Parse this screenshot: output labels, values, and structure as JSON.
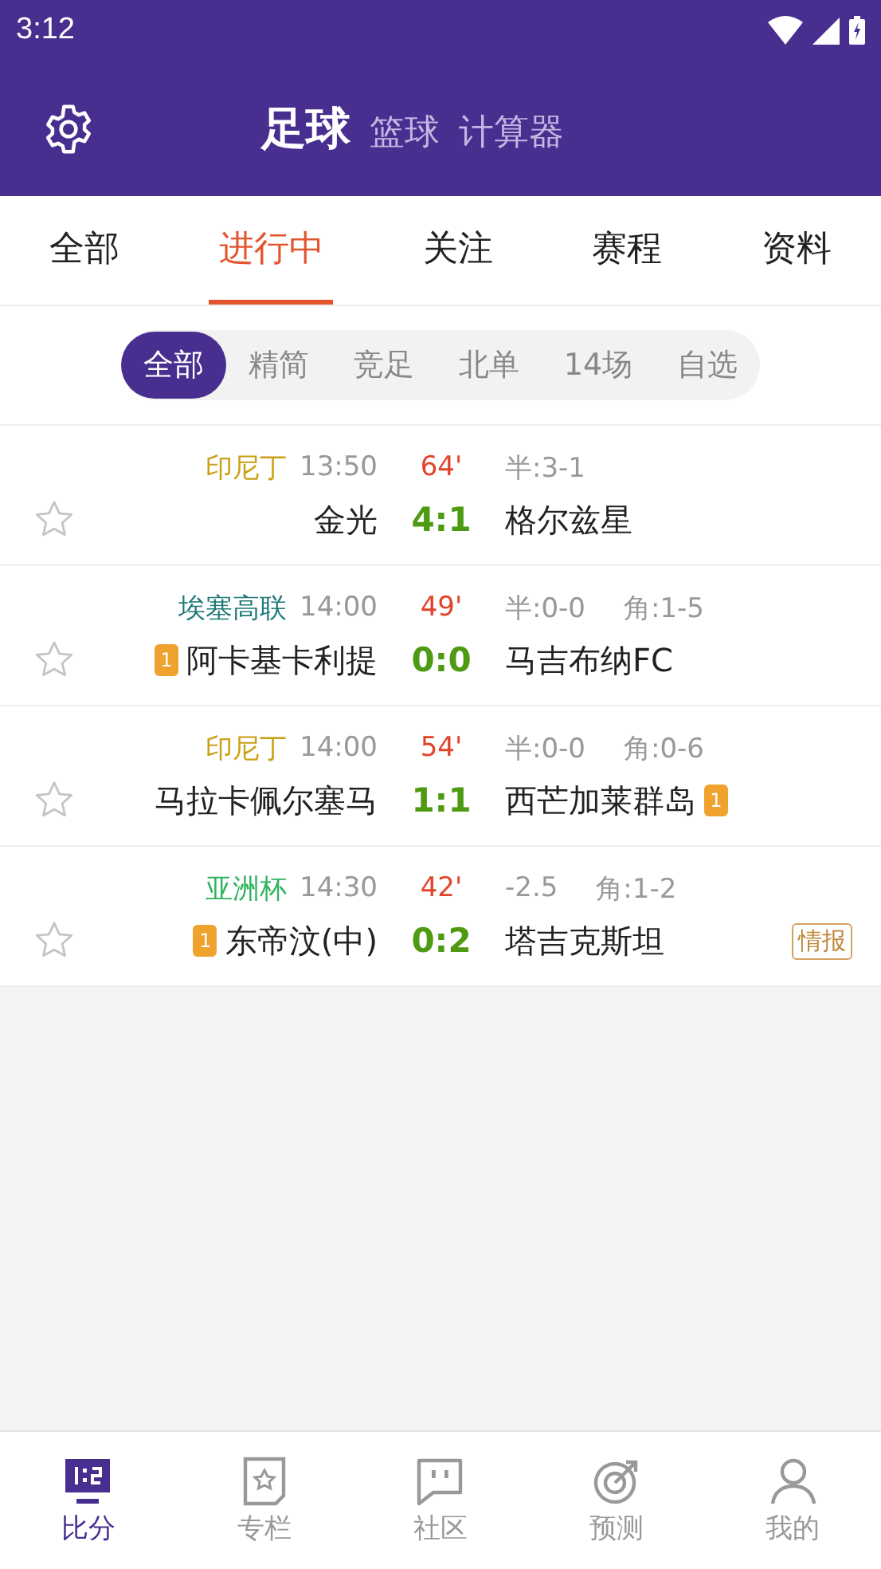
{
  "status_bar": {
    "time": "3:12"
  },
  "header": {
    "sports": [
      {
        "label": "足球",
        "selected": true
      },
      {
        "label": "篮球",
        "selected": false
      },
      {
        "label": "计算器",
        "selected": false
      }
    ]
  },
  "tabs": [
    {
      "label": "全部",
      "selected": false
    },
    {
      "label": "进行中",
      "selected": true
    },
    {
      "label": "关注",
      "selected": false
    },
    {
      "label": "赛程",
      "selected": false
    },
    {
      "label": "资料",
      "selected": false
    }
  ],
  "filters": [
    {
      "label": "全部",
      "selected": true
    },
    {
      "label": "精简",
      "selected": false
    },
    {
      "label": "竞足",
      "selected": false
    },
    {
      "label": "北单",
      "selected": false
    },
    {
      "label": "14场",
      "selected": false
    },
    {
      "label": "自选",
      "selected": false
    }
  ],
  "matches": [
    {
      "league": "印尼丁",
      "color": "#c9a016",
      "time": "13:50",
      "minute": "64'",
      "info": [
        "半:3-1"
      ],
      "home": "金光",
      "score": "4:1",
      "away": "格尔兹星",
      "starred": false
    },
    {
      "league": "埃塞高联",
      "color": "#1f7a78",
      "time": "14:00",
      "minute": "49'",
      "info": [
        "半:0-0",
        "角:1-5"
      ],
      "home": "阿卡基卡利提",
      "home_card": "1",
      "score": "0:0",
      "away": "马吉布纳FC",
      "starred": false
    },
    {
      "league": "印尼丁",
      "color": "#c9a016",
      "time": "14:00",
      "minute": "54'",
      "info": [
        "半:0-0",
        "角:0-6"
      ],
      "home": "马拉卡佩尔塞马",
      "score": "1:1",
      "away": "西芒加莱群岛",
      "away_card": "1",
      "starred": false
    },
    {
      "league": "亚洲杯",
      "color": "#2fb35f",
      "time": "14:30",
      "minute": "42'",
      "info": [
        "-2.5",
        "角:1-2"
      ],
      "home": "东帝汶(中)",
      "home_card": "1",
      "score": "0:2",
      "away": "塔吉克斯坦",
      "tag": "情报",
      "starred": false
    }
  ],
  "bottom_nav": [
    {
      "label": "比分",
      "kind": "score",
      "selected": true
    },
    {
      "label": "专栏",
      "kind": "column",
      "selected": false
    },
    {
      "label": "社区",
      "kind": "community",
      "selected": false
    },
    {
      "label": "预测",
      "kind": "predict",
      "selected": false
    },
    {
      "label": "我的",
      "kind": "profile",
      "selected": false
    }
  ]
}
